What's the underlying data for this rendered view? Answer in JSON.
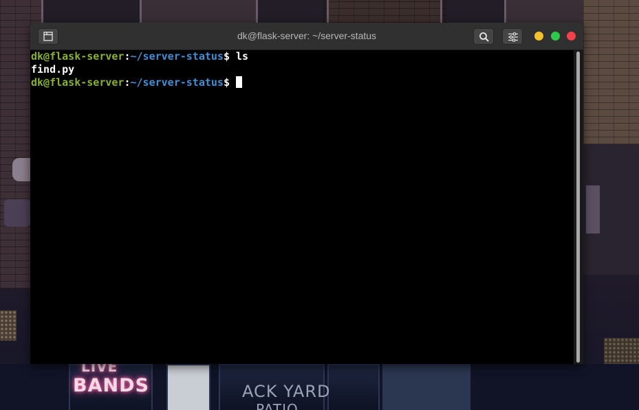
{
  "window": {
    "title": "dk@flask-server: ~/server-status"
  },
  "titlebar": {
    "new_tab_icon": "new-tab-icon",
    "search_icon": "search-icon",
    "menu_icon": "sliders-menu-icon",
    "controls": [
      {
        "name": "minimize",
        "color": "#f5c02a"
      },
      {
        "name": "maximize",
        "color": "#2ec94a"
      },
      {
        "name": "close",
        "color": "#f0424a"
      }
    ]
  },
  "terminal": {
    "lines": [
      {
        "user_host": "dk@flask-server",
        "sep": ":",
        "path": "~/server-status",
        "prompt": "$ ",
        "command": "ls"
      },
      {
        "output": "find.py"
      },
      {
        "user_host": "dk@flask-server",
        "sep": ":",
        "path": "~/server-status",
        "prompt": "$ ",
        "command": ""
      }
    ],
    "colors": {
      "user_host": "#8ab22b",
      "path": "#3f8fd6",
      "text": "#ffffff",
      "background": "#000000",
      "cursor": "#ffffff"
    }
  },
  "wallpaper": {
    "signs": {
      "live": "LIVE",
      "bands": "BANDS",
      "yard": "ACK YARD",
      "patio": "PATIO"
    }
  }
}
